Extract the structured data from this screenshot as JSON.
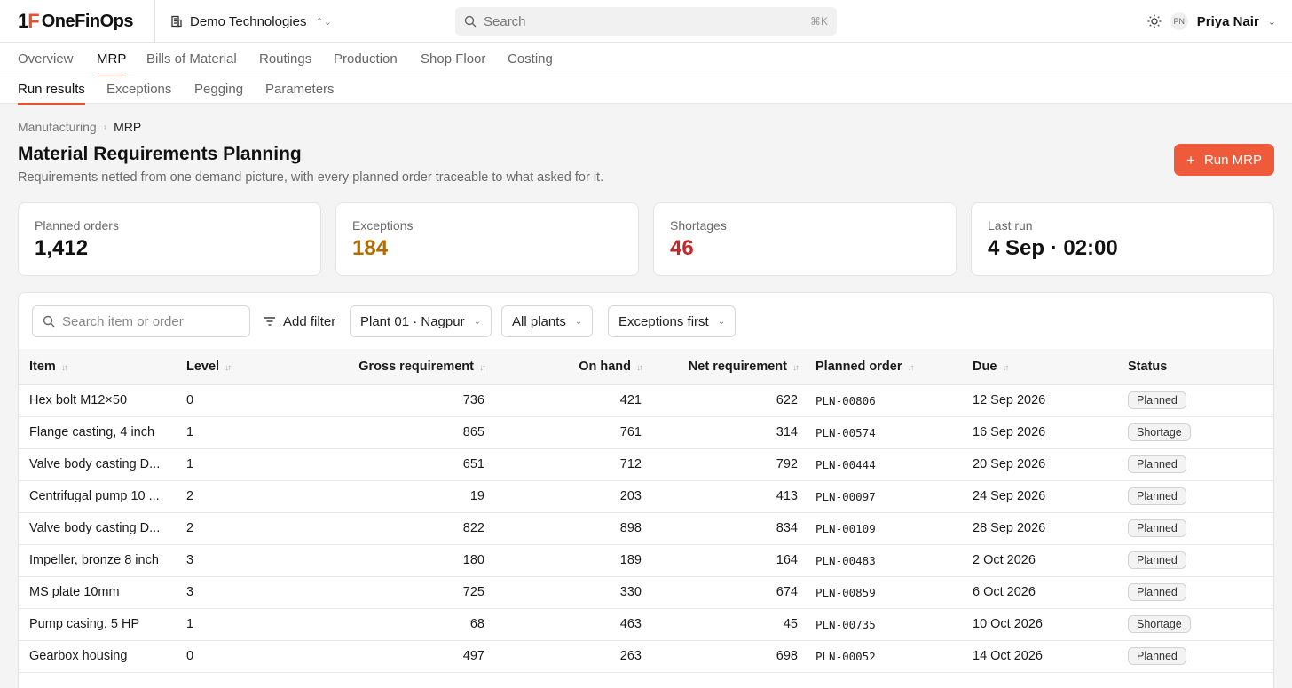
{
  "app": {
    "logo_mark_1": "1",
    "logo_mark_2": "F",
    "logo_text": "OneFinOps"
  },
  "org": {
    "name": "Demo Technologies"
  },
  "search": {
    "placeholder": "Search",
    "shortcut": "⌘K"
  },
  "user": {
    "initials": "PN",
    "name": "Priya Nair"
  },
  "nav": {
    "tabs": [
      "Overview",
      "MRP",
      "Bills of Material",
      "Routings",
      "Production",
      "Shop Floor",
      "Costing"
    ],
    "active": "MRP"
  },
  "subnav": {
    "tabs": [
      "Run results",
      "Exceptions",
      "Pegging",
      "Parameters"
    ],
    "active": "Run results"
  },
  "breadcrumb": {
    "parent": "Manufacturing",
    "current": "MRP"
  },
  "page": {
    "title": "Material Requirements Planning",
    "subtitle": "Requirements netted from one demand picture, with every planned order traceable to what asked for it.",
    "run_button": "Run MRP"
  },
  "kpis": [
    {
      "label": "Planned orders",
      "value": "1,412"
    },
    {
      "label": "Exceptions",
      "value": "184"
    },
    {
      "label": "Shortages",
      "value": "46"
    },
    {
      "label": "Last run",
      "value": "4 Sep · 02:00"
    }
  ],
  "colors": {
    "accent": "#ef5a3a",
    "amber": "#b26b00",
    "red": "#c62828"
  },
  "filters": {
    "search_placeholder": "Search item or order",
    "add_filter": "Add filter",
    "plant": "Plant 01 · Nagpur",
    "scope": "All plants",
    "sort": "Exceptions first"
  },
  "table": {
    "headers": {
      "item": "Item",
      "level": "Level",
      "gross": "Gross requirement",
      "onhand": "On hand",
      "net": "Net requirement",
      "po": "Planned order",
      "due": "Due",
      "status": "Status"
    },
    "rows": [
      {
        "item": "Hex bolt M12×50",
        "level": "0",
        "gross": "736",
        "onhand": "421",
        "net": "622",
        "po": "PLN-00806",
        "due": "12 Sep 2026",
        "status": "Planned"
      },
      {
        "item": "Flange casting, 4 inch",
        "level": "1",
        "gross": "865",
        "onhand": "761",
        "net": "314",
        "po": "PLN-00574",
        "due": "16 Sep 2026",
        "status": "Shortage"
      },
      {
        "item": "Valve body casting D...",
        "level": "1",
        "gross": "651",
        "onhand": "712",
        "net": "792",
        "po": "PLN-00444",
        "due": "20 Sep 2026",
        "status": "Planned"
      },
      {
        "item": "Centrifugal pump 10 ...",
        "level": "2",
        "gross": "19",
        "onhand": "203",
        "net": "413",
        "po": "PLN-00097",
        "due": "24 Sep 2026",
        "status": "Planned"
      },
      {
        "item": "Valve body casting D...",
        "level": "2",
        "gross": "822",
        "onhand": "898",
        "net": "834",
        "po": "PLN-00109",
        "due": "28 Sep 2026",
        "status": "Planned"
      },
      {
        "item": "Impeller, bronze 8 inch",
        "level": "3",
        "gross": "180",
        "onhand": "189",
        "net": "164",
        "po": "PLN-00483",
        "due": "2 Oct 2026",
        "status": "Planned"
      },
      {
        "item": "MS plate 10mm",
        "level": "3",
        "gross": "725",
        "onhand": "330",
        "net": "674",
        "po": "PLN-00859",
        "due": "6 Oct 2026",
        "status": "Planned"
      },
      {
        "item": "Pump casing, 5 HP",
        "level": "1",
        "gross": "68",
        "onhand": "463",
        "net": "45",
        "po": "PLN-00735",
        "due": "10 Oct 2026",
        "status": "Shortage"
      },
      {
        "item": "Gearbox housing",
        "level": "0",
        "gross": "497",
        "onhand": "263",
        "net": "698",
        "po": "PLN-00052",
        "due": "14 Oct 2026",
        "status": "Planned"
      }
    ]
  }
}
